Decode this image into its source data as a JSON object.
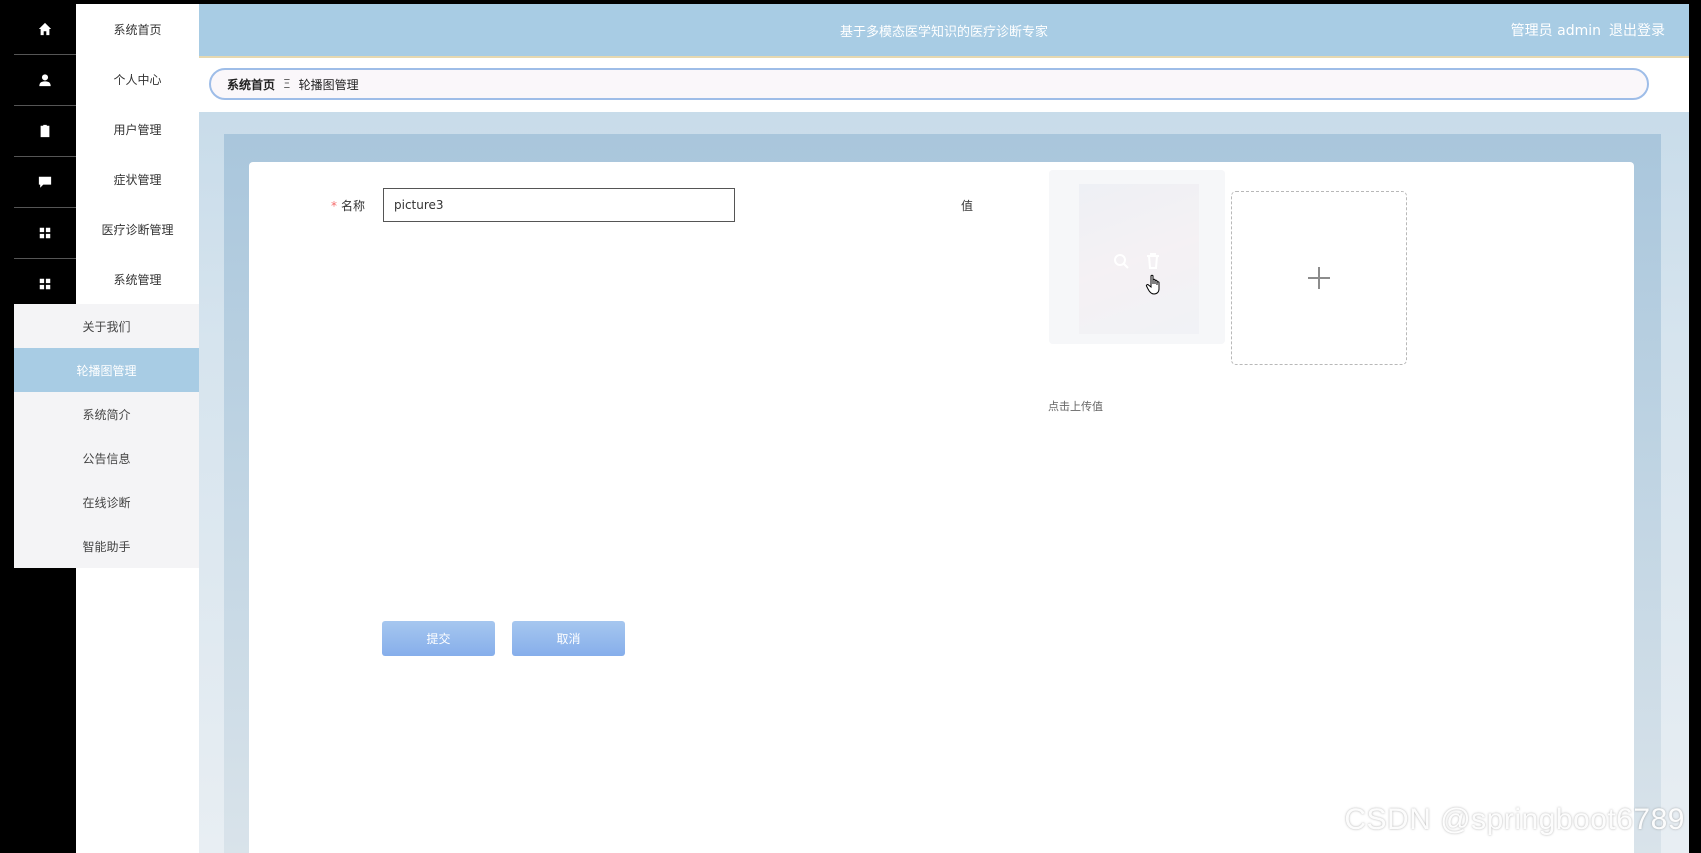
{
  "header": {
    "title": "基于多模态医学知识的医疗诊断专家",
    "user_label": "管理员 admin",
    "logout_label": "退出登录"
  },
  "sidebar": {
    "items": [
      {
        "label": "系统首页",
        "icon": "home-icon"
      },
      {
        "label": "个人中心",
        "icon": "user-icon"
      },
      {
        "label": "用户管理",
        "icon": "clipboard-icon"
      },
      {
        "label": "症状管理",
        "icon": "chat-icon"
      },
      {
        "label": "医疗诊断管理",
        "icon": "grid-icon"
      },
      {
        "label": "系统管理",
        "icon": "grid-icon"
      }
    ],
    "submenu": [
      {
        "label": "关于我们",
        "active": false
      },
      {
        "label": "轮播图管理",
        "active": true
      },
      {
        "label": "系统简介",
        "active": false
      },
      {
        "label": "公告信息",
        "active": false
      },
      {
        "label": "在线诊断",
        "active": false
      },
      {
        "label": "智能助手",
        "active": false
      }
    ]
  },
  "breadcrumb": {
    "home": "系统首页",
    "separator": "Ξ",
    "current": "轮播图管理"
  },
  "form": {
    "name_label": "名称",
    "required_mark": "*",
    "name_value": "picture3",
    "value_label": "值",
    "upload_tip": "点击上传值",
    "submit_label": "提交",
    "cancel_label": "取消"
  },
  "watermark": "CSDN @springboot6789",
  "colors": {
    "topbar": "#a8cce4",
    "active_menu": "#a8cce4",
    "button": "#86aeeb",
    "required": "#f56c6c"
  }
}
